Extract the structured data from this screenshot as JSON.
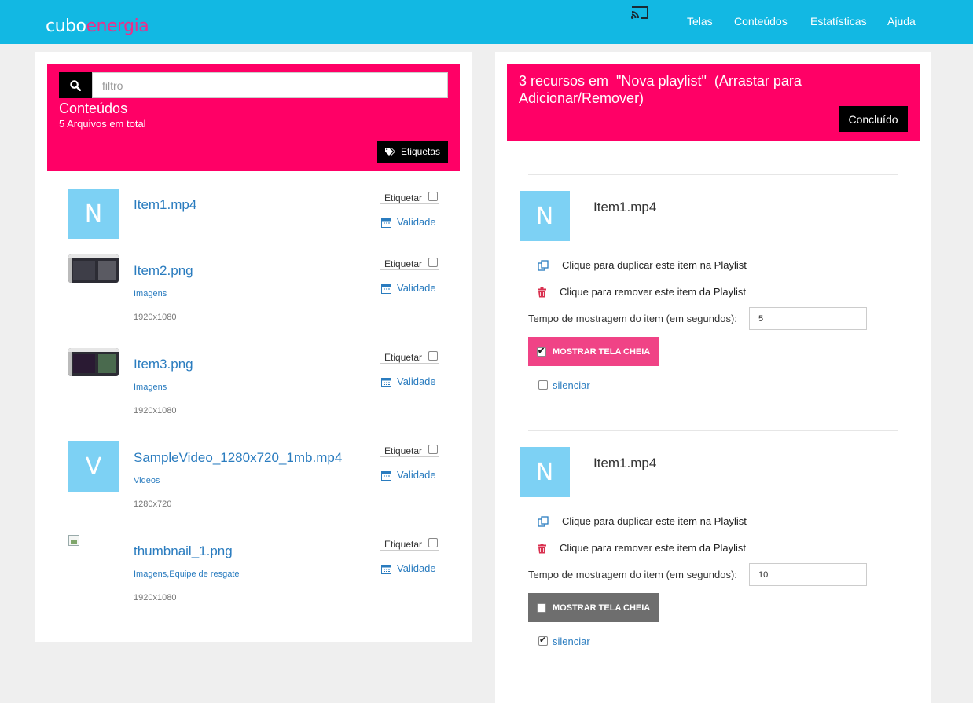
{
  "navbar": {
    "logo_part1": "cubo",
    "logo_part2": "energia",
    "cast_icon": "cast-icon",
    "links": [
      "Telas",
      "Conteúdos",
      "Estatísticas",
      "Ajuda"
    ],
    "bg": "#12b8e3"
  },
  "library": {
    "search_placeholder": "filtro",
    "title": "Conteúdos",
    "subtitle": "5 Arquivos em total",
    "tags_button": "Etiquetas",
    "accent": "#ff0066",
    "tag_label": "Etiquetar",
    "validity_label": "Validade",
    "items": [
      {
        "name": "Item1.mp4",
        "thumb_letter": "N",
        "category": "",
        "resolution": ""
      },
      {
        "name": "Item2.png",
        "thumb_letter": "",
        "category": "Imagens",
        "resolution": "1920x1080"
      },
      {
        "name": "Item3.png",
        "thumb_letter": "",
        "category": "Imagens",
        "resolution": "1920x1080"
      },
      {
        "name": "SampleVideo_1280x720_1mb.mp4",
        "thumb_letter": "V",
        "category": "Videos",
        "resolution": "1280x720"
      },
      {
        "name": "thumbnail_1.png",
        "thumb_letter": "",
        "category": "Imagens,Equipe de resgate",
        "resolution": "1920x1080"
      }
    ]
  },
  "playlist": {
    "title": "3 recursos em  \"Nova playlist\"  (Arrastar para Adicionar/Remover)",
    "done_button": "Concluído",
    "duplicate_label": "Clique para duplicar este item na Playlist",
    "remove_label": "Clique para remover este item da Playlist",
    "duration_label": "Tempo de mostragem do item (em segundos):",
    "fullscreen_label": "MOSTRAR TELA CHEIA",
    "mute_label": "silenciar",
    "items": [
      {
        "name": "Item1.mp4",
        "thumb_letter": "N",
        "duration": "5",
        "fullscreen": true,
        "mute": false
      },
      {
        "name": "Item1.mp4",
        "thumb_letter": "N",
        "duration": "10",
        "fullscreen": false,
        "mute": true
      }
    ]
  }
}
